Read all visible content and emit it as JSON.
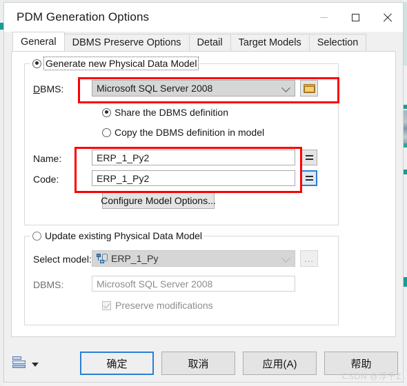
{
  "window": {
    "title": "PDM Generation Options",
    "controls": {
      "minimize": "minimize-button",
      "maximize": "maximize-button",
      "close": "close-button"
    }
  },
  "tabs": [
    {
      "label": "General",
      "active": true
    },
    {
      "label": "DBMS Preserve Options",
      "active": false
    },
    {
      "label": "Detail",
      "active": false
    },
    {
      "label": "Target Models",
      "active": false
    },
    {
      "label": "Selection",
      "active": false
    }
  ],
  "generate_group": {
    "legend": "Generate new Physical Data Model",
    "selected": true,
    "dbms_label": "DBMS:",
    "dbms_value": "Microsoft SQL Server 2008",
    "browse_icon": "folder-icon",
    "share_option": "Share the DBMS definition",
    "share_selected": true,
    "copy_option": "Copy the DBMS definition in model",
    "copy_selected": false,
    "name_label": "Name:",
    "name_value": "ERP_1_Py2",
    "code_label": "Code:",
    "code_value": "ERP_1_Py2",
    "equals_button_label": "=",
    "configure_button": "Configure Model Options..."
  },
  "update_group": {
    "legend": "Update existing Physical Data Model",
    "selected": false,
    "select_model_label": "Select model:",
    "select_model_value": "ERP_1_Py",
    "select_model_icon": "model-icon",
    "browse_button_label": "...",
    "dbms_label": "DBMS:",
    "dbms_value": "Microsoft SQL Server 2008",
    "preserve_label": "Preserve modifications",
    "preserve_checked": true
  },
  "footer": {
    "print_icon": "print-report-icon",
    "print_dropdown_icon": "chevron-down-icon",
    "ok_label": "确定",
    "cancel_label": "取消",
    "apply_label": "应用(A)",
    "help_label": "帮助"
  },
  "watermark": "CSDN @浮千Z",
  "colors": {
    "accent": "#2a7fd4",
    "annotation": "#fa0000",
    "teal": "#1a9b97",
    "folder": "#d9a23a"
  }
}
